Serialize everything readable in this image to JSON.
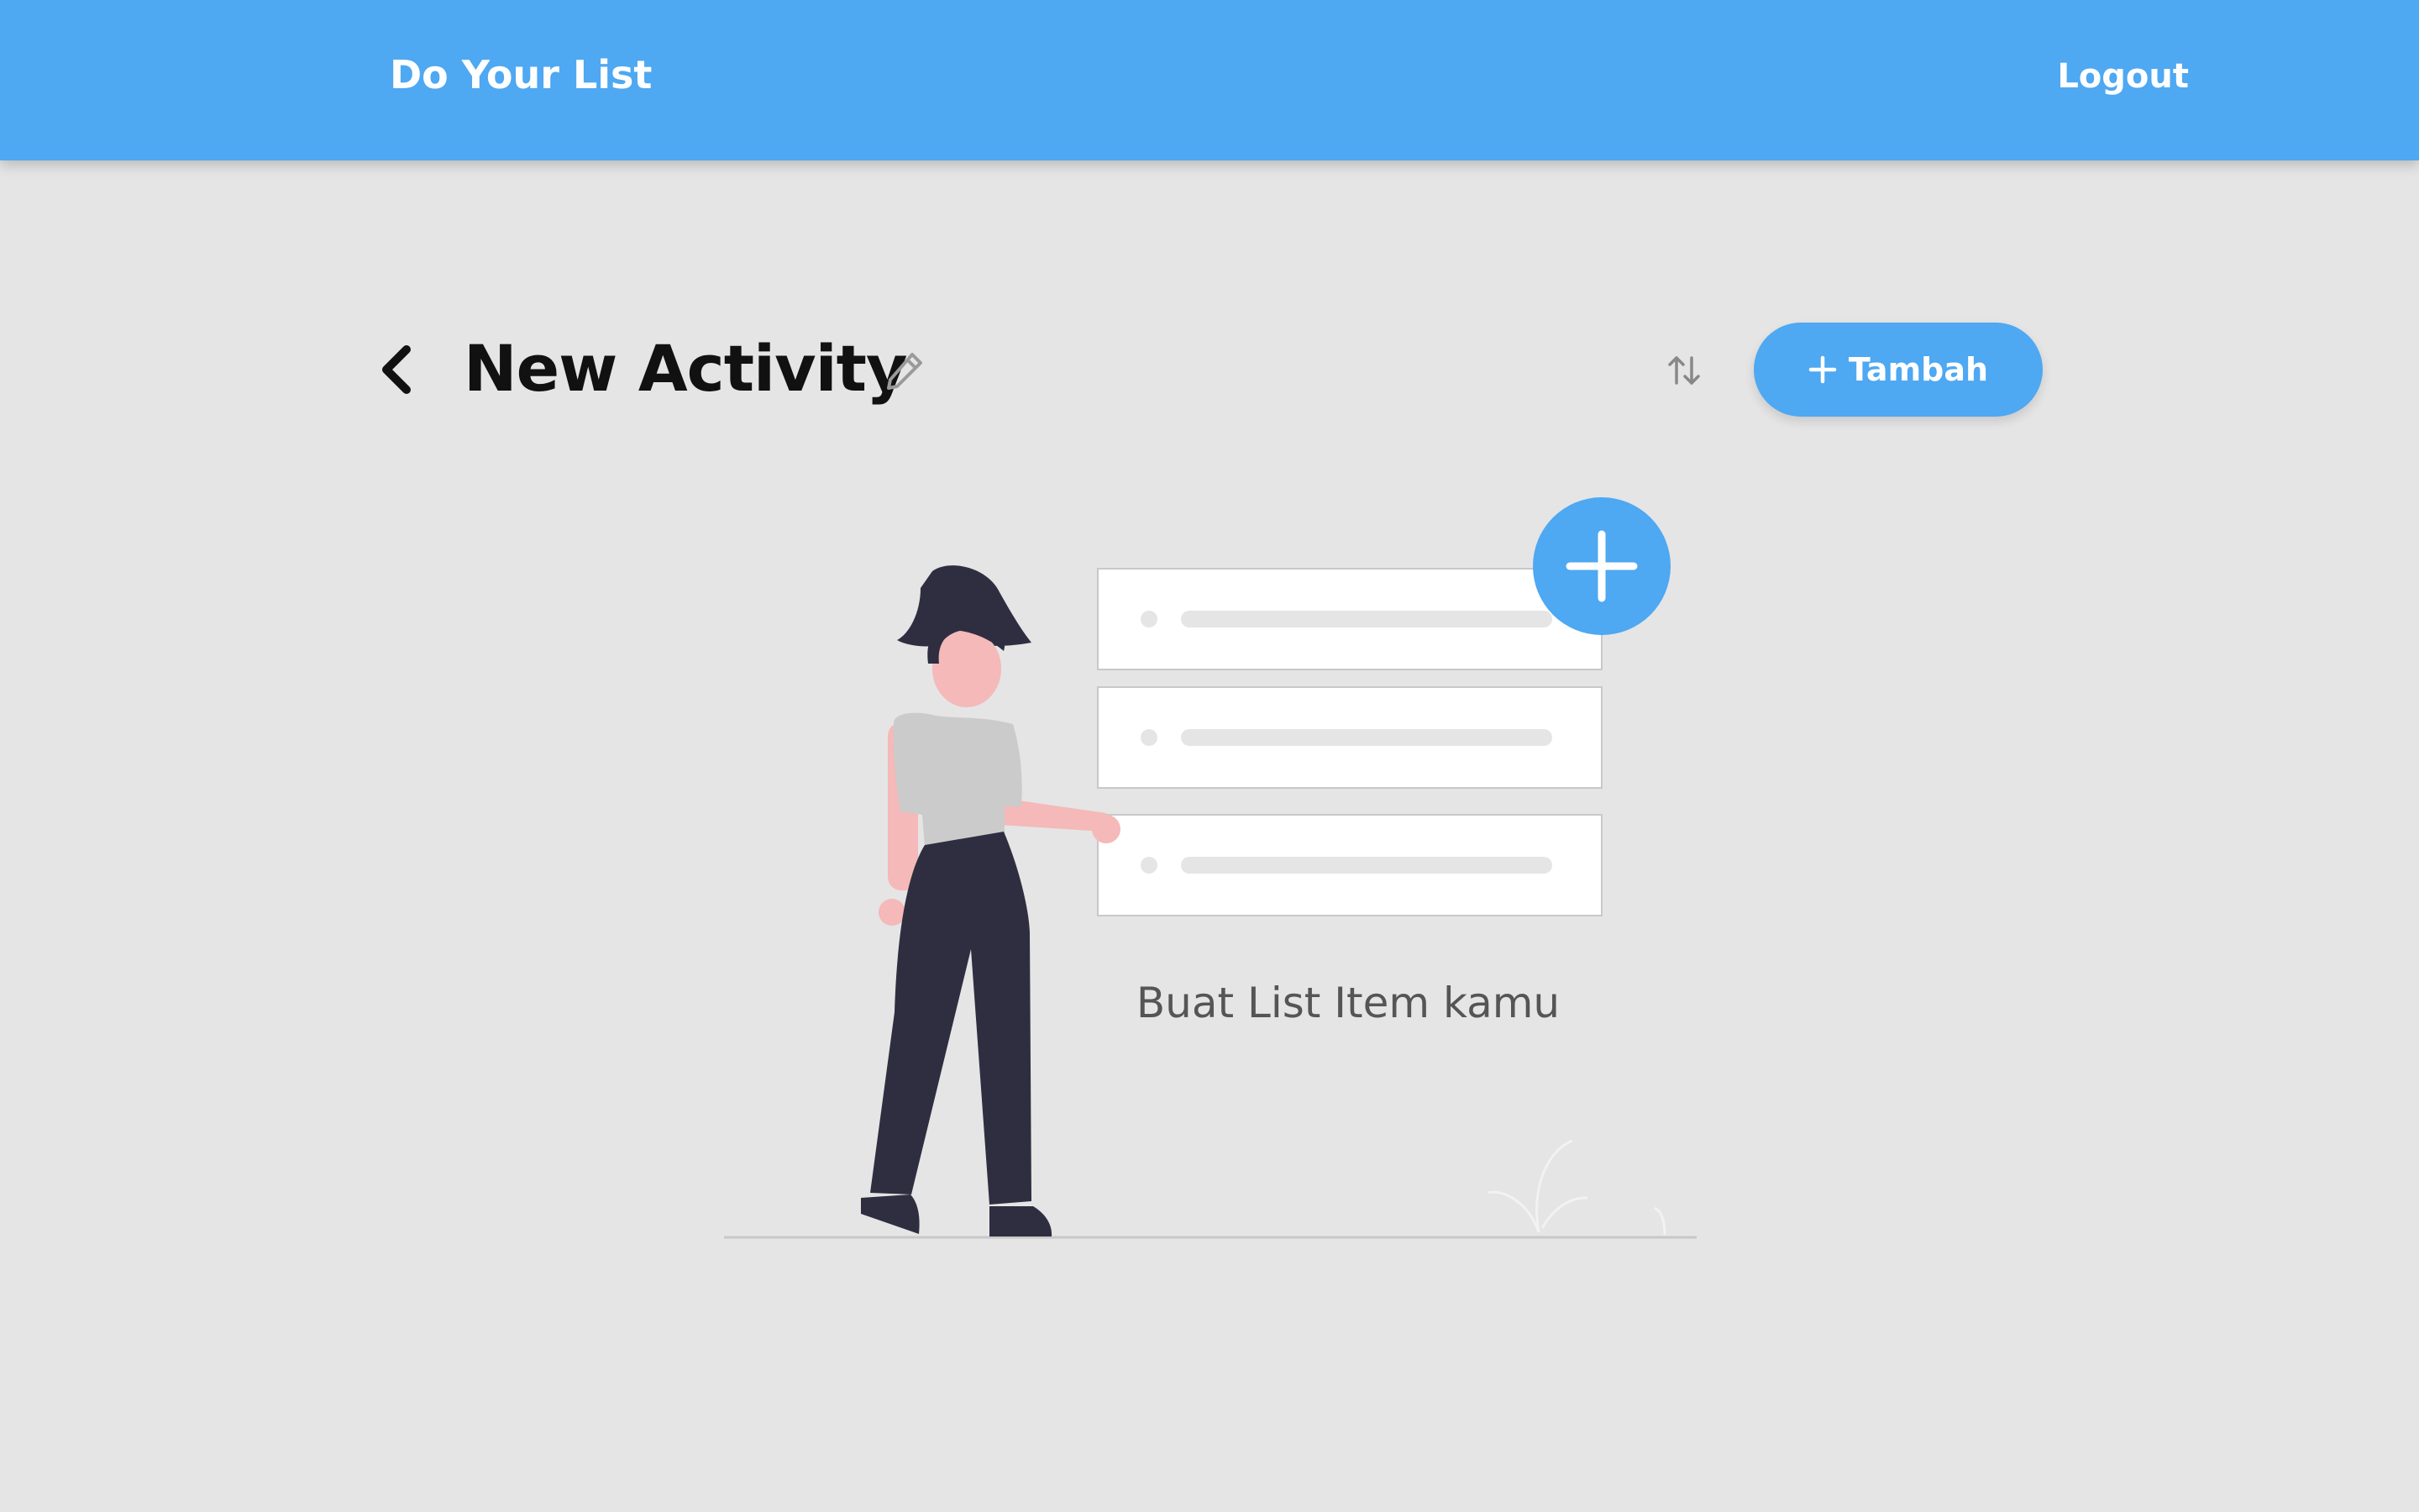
{
  "navbar": {
    "title": "Do Your List",
    "logout_label": "Logout",
    "background_color": "#4ea8f2"
  },
  "activity": {
    "title": "New Activity",
    "back_icon": "chevron-left-icon",
    "edit_icon": "pencil-icon",
    "sort_icon": "sort-arrows-icon",
    "add_button_label": "Tambah",
    "add_button_icon": "plus-icon"
  },
  "empty_state": {
    "message": "Buat List Item kamu",
    "illustration": "woman-with-list-illustration"
  },
  "colors": {
    "accent": "#4ea8f2",
    "background": "#e5e5e5",
    "title_text": "#111111"
  }
}
